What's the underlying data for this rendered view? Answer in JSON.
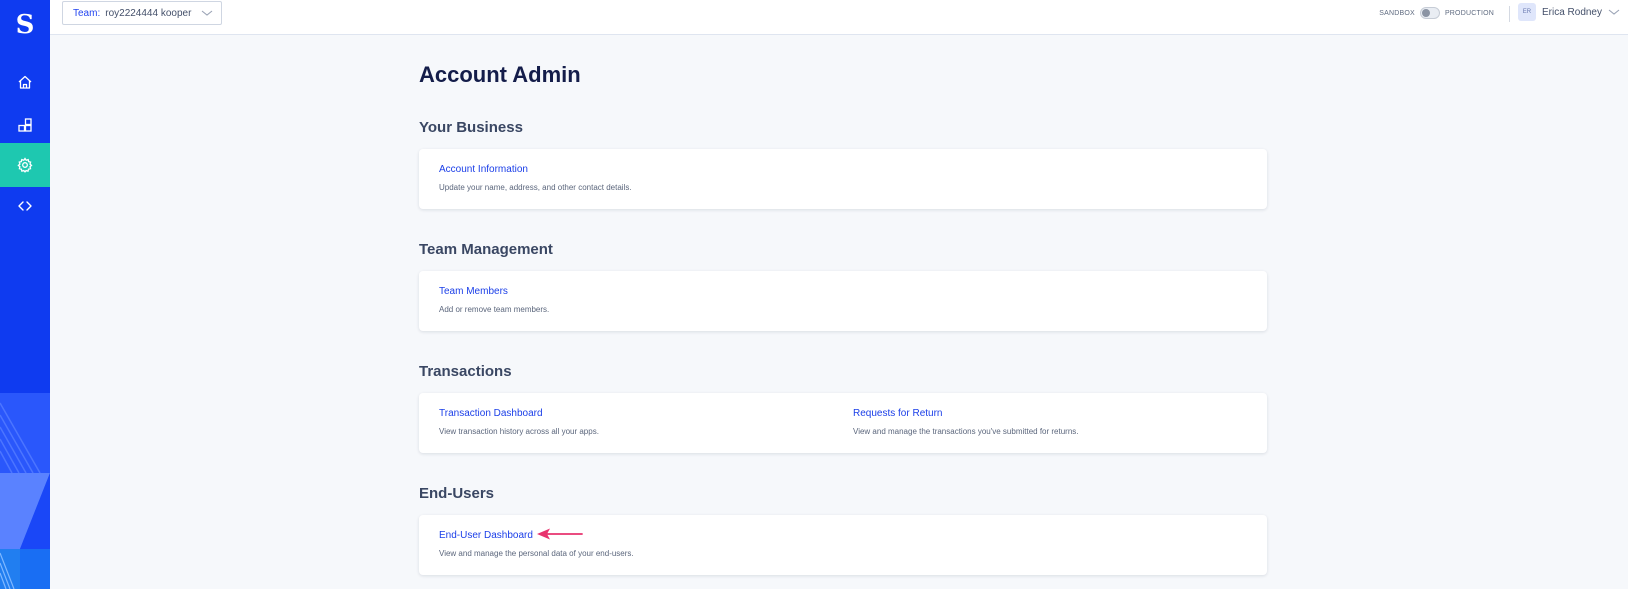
{
  "sidebar": {
    "logo": "S",
    "items": [
      {
        "name": "home",
        "icon": "home-icon"
      },
      {
        "name": "apps",
        "icon": "apps-icon"
      },
      {
        "name": "settings",
        "icon": "gear-icon",
        "active": true
      },
      {
        "name": "developer",
        "icon": "code-icon"
      }
    ],
    "brand_color": "#0f3bf0",
    "active_color": "#1ec8b0"
  },
  "topbar": {
    "team_label": "Team:",
    "team_value": "roy2224444 kooper",
    "env_left": "SANDBOX",
    "env_right": "PRODUCTION",
    "user_initials": "ER",
    "user_name": "Erica Rodney"
  },
  "page": {
    "title": "Account Admin",
    "sections": [
      {
        "title": "Your Business",
        "items": [
          {
            "title": "Account Information",
            "desc": "Update your name, address, and other contact details."
          }
        ]
      },
      {
        "title": "Team Management",
        "items": [
          {
            "title": "Team Members",
            "desc": "Add or remove team members."
          }
        ]
      },
      {
        "title": "Transactions",
        "items": [
          {
            "title": "Transaction Dashboard",
            "desc": "View transaction history across all your apps."
          },
          {
            "title": "Requests for Return",
            "desc": "View and manage the transactions you've submitted for returns."
          }
        ]
      },
      {
        "title": "End-Users",
        "items": [
          {
            "title": "End-User Dashboard",
            "desc": "View and manage the personal data of your end-users."
          }
        ]
      }
    ]
  },
  "annotation": {
    "icon": "arrow-left-icon",
    "color": "#e8336e"
  }
}
